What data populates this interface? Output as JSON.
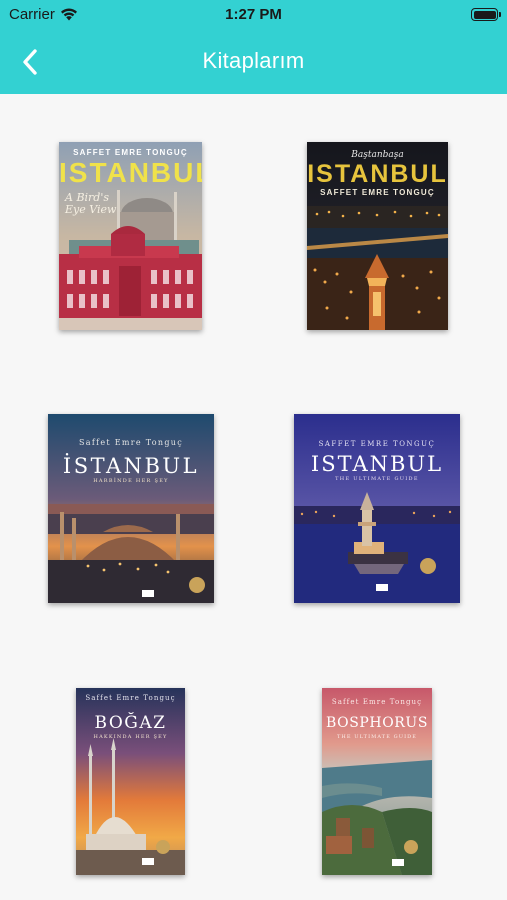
{
  "status_bar": {
    "carrier": "Carrier",
    "time": "1:27 PM"
  },
  "navbar": {
    "title": "Kitaplarım",
    "back_icon": "chevron-left-icon"
  },
  "colors": {
    "accent": "#33d1d2",
    "background": "#f7f7f7"
  },
  "books": [
    {
      "author": "SAFFET EMRE TONGUÇ",
      "title": "ISTANBUL",
      "subtitle": "A Bird's Eye View"
    },
    {
      "series": "Baştanbaşa",
      "title": "ISTANBUL",
      "author": "SAFFET EMRE TONGUÇ"
    },
    {
      "author": "Saffet Emre Tonguç",
      "title": "İSTANBUL",
      "subtitle": "HARBİNDE HER ŞEY"
    },
    {
      "author": "SAFFET EMRE TONGUÇ",
      "title": "ISTANBUL",
      "subtitle": "THE ULTIMATE GUIDE"
    },
    {
      "author": "Saffet Emre Tonguç",
      "title": "BOĞAZ",
      "subtitle": "HAKKINDA HER ŞEY"
    },
    {
      "author": "Saffet Emre Tonguç",
      "title": "BOSPHORUS",
      "subtitle": "THE ULTIMATE GUIDE"
    }
  ]
}
